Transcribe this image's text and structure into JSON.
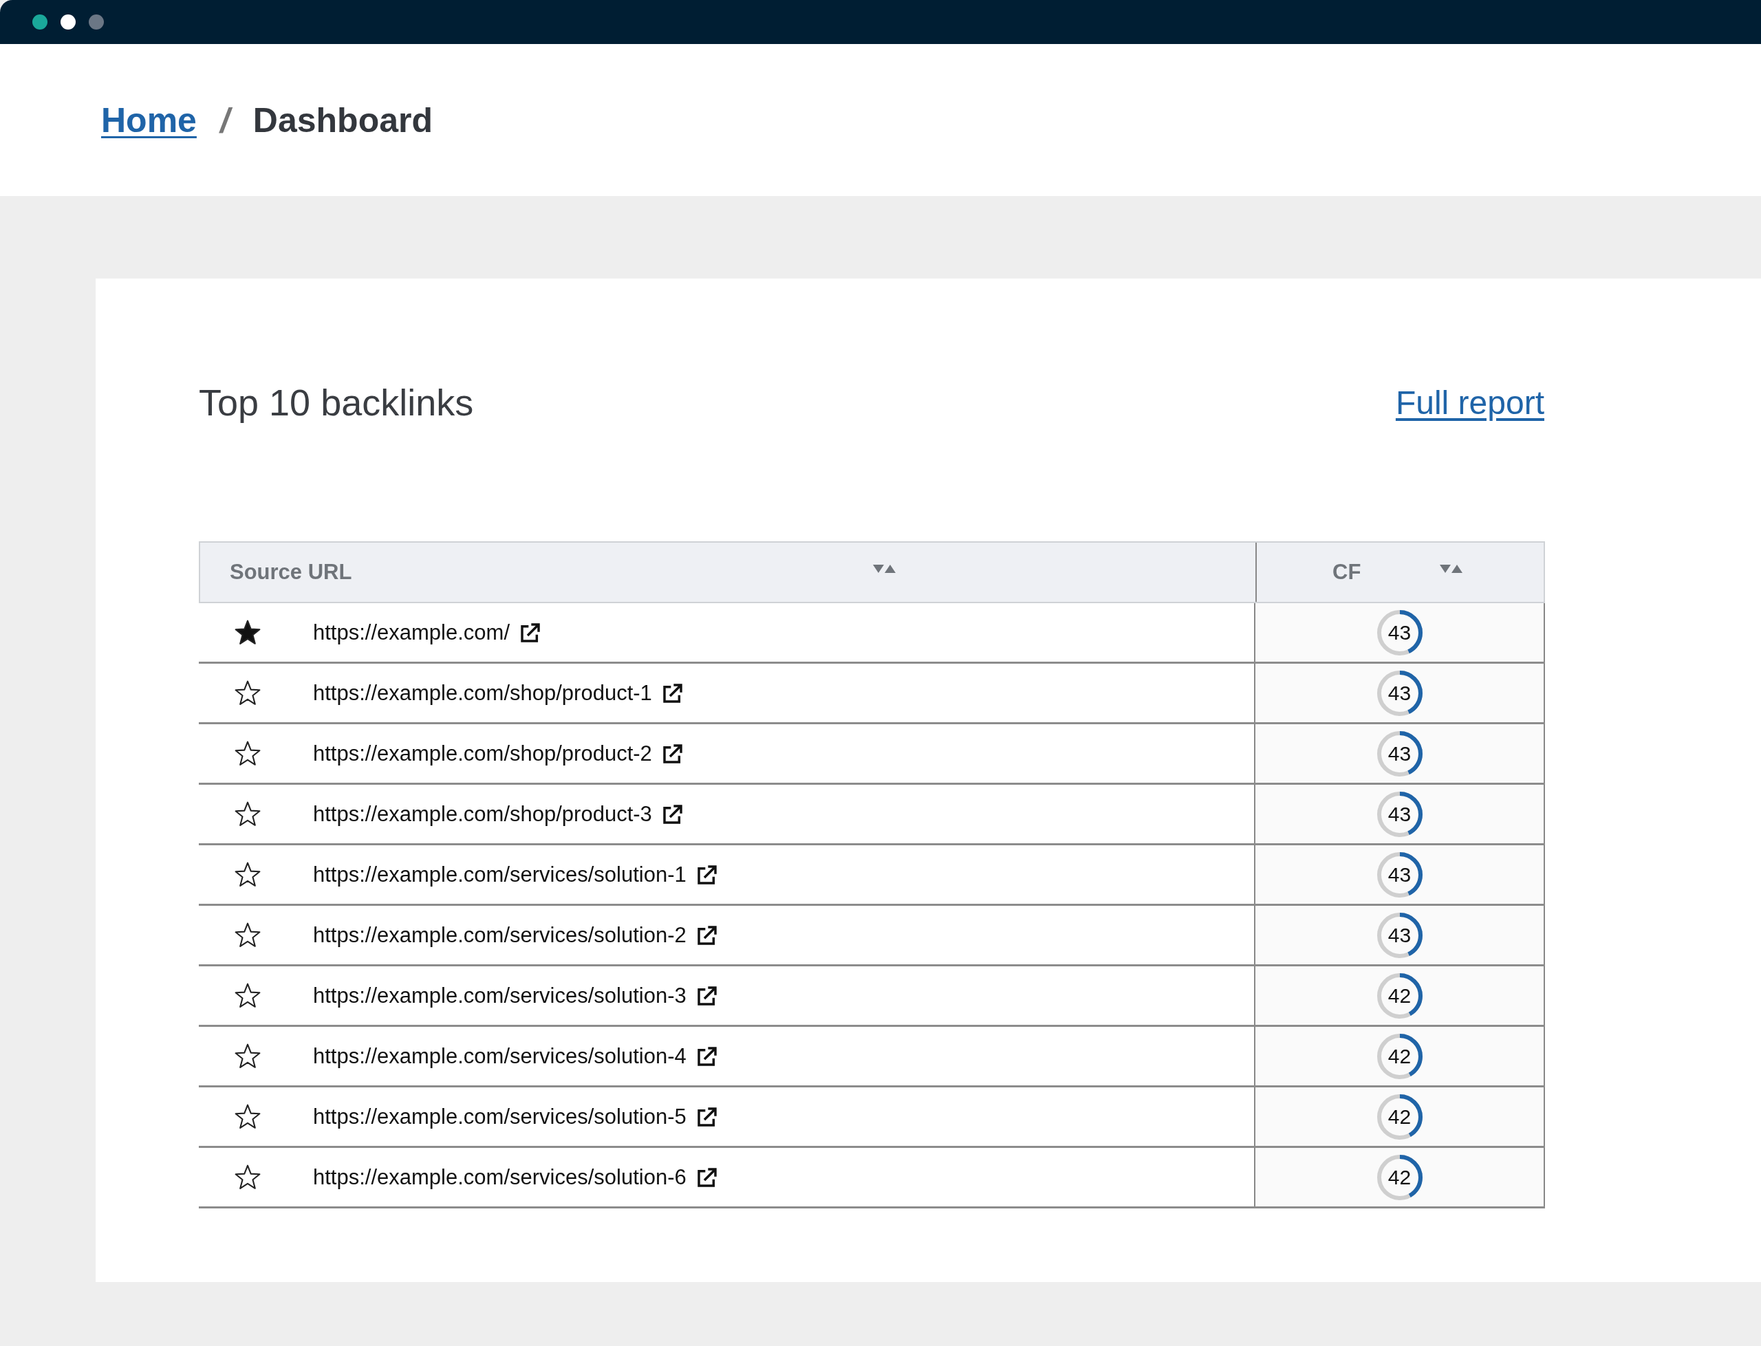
{
  "window": {
    "controls": [
      {
        "color": "#1aa89a"
      },
      {
        "color": "#ffffff"
      },
      {
        "color": "#6b7785"
      }
    ]
  },
  "breadcrumb": {
    "items": [
      {
        "label": "Home",
        "kind": "link"
      },
      {
        "label": "/",
        "kind": "separator"
      },
      {
        "label": "Dashboard",
        "kind": "current"
      }
    ]
  },
  "card": {
    "title": "Top 10 backlinks",
    "link": "Full report"
  },
  "table": {
    "columns": [
      {
        "label": "Source URL"
      },
      {
        "label": "CF"
      }
    ],
    "rows": [
      {
        "starred": true,
        "url": "https://example.com/",
        "cf": "43",
        "level": 0.43
      },
      {
        "starred": false,
        "url": "https://example.com/shop/product-1",
        "cf": "43",
        "level": 0.43
      },
      {
        "starred": false,
        "url": "https://example.com/shop/product-2",
        "cf": "43",
        "level": 0.43
      },
      {
        "starred": false,
        "url": "https://example.com/shop/product-3",
        "cf": "43",
        "level": 0.43
      },
      {
        "starred": false,
        "url": "https://example.com/services/solution-1",
        "cf": "43",
        "level": 0.43
      },
      {
        "starred": false,
        "url": "https://example.com/services/solution-2",
        "cf": "43",
        "level": 0.43
      },
      {
        "starred": false,
        "url": "https://example.com/services/solution-3",
        "cf": "42",
        "level": 0.42
      },
      {
        "starred": false,
        "url": "https://example.com/services/solution-4",
        "cf": "42",
        "level": 0.42
      },
      {
        "starred": false,
        "url": "https://example.com/services/solution-5",
        "cf": "42",
        "level": 0.42
      },
      {
        "starred": false,
        "url": "https://example.com/services/solution-6",
        "cf": "42",
        "level": 0.42
      }
    ]
  }
}
